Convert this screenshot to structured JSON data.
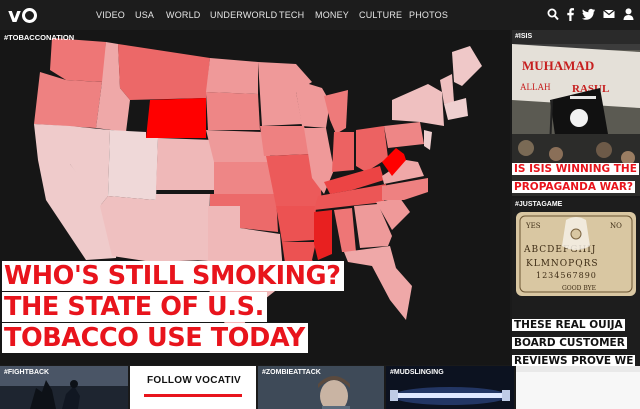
{
  "site": {
    "logo": "vocativ"
  },
  "nav": {
    "items": [
      "VIDEO",
      "USA",
      "WORLD",
      "UNDERWORLD",
      "TECH",
      "MONEY",
      "CULTURE",
      "PHOTOS"
    ],
    "icons": [
      "search-icon",
      "facebook-icon",
      "twitter-icon",
      "email-icon",
      "user-icon"
    ]
  },
  "hero": {
    "tag": "#TOBACCONATION",
    "headline": [
      "WHO'S STILL SMOKING?",
      "THE STATE OF U.S.",
      "TOBACCO USE TODAY"
    ],
    "highlight_color": "#ff0000",
    "accent": "#e8141c"
  },
  "sidebar": [
    {
      "tag": "#ISIS",
      "title": "IS ISIS WINNING THE PROPAGANDA WAR?",
      "style": "red"
    },
    {
      "tag": "#JUSTAGAME",
      "title": "THESE REAL OUIJA BOARD CUSTOMER REVIEWS PROVE WE ARE ALL CRAZY",
      "style": "black"
    }
  ],
  "bottom": {
    "tiles": [
      {
        "tag": "#FIGHTBACK"
      },
      {
        "follow": "FOLLOW VOCATIV"
      },
      {
        "tag": "#ZOMBIEATTACK"
      },
      {
        "tag": "#MUDSLINGING"
      },
      {
        "tag": ""
      }
    ]
  }
}
